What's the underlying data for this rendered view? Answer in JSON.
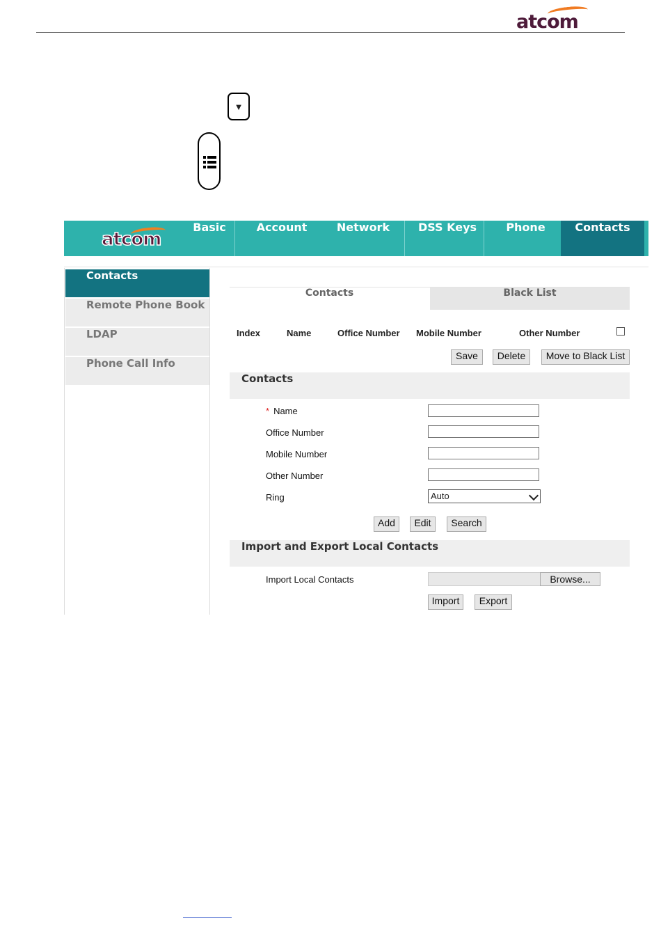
{
  "doc": {
    "logo_text": "atcom"
  },
  "ui": {
    "logo_text": "atcom",
    "nav": [
      "Basic",
      "Account",
      "Network",
      "DSS Keys",
      "Phone",
      "Contacts"
    ],
    "sidebar": [
      "Contacts",
      "Remote Phone Book",
      "LDAP",
      "Phone Call Info"
    ],
    "subtabs": [
      "Contacts",
      "Black List"
    ],
    "columns": [
      "Index",
      "Name",
      "Office Number",
      "Mobile Number",
      "Other Number"
    ],
    "list_buttons": {
      "save": "Save",
      "delete": "Delete",
      "move": "Move to Black List"
    },
    "contacts_section": {
      "title": "Contacts",
      "required_mark": "*",
      "fields": [
        "Name",
        "Office Number",
        "Mobile Number",
        "Other Number",
        "Ring"
      ],
      "ring_value": "Auto",
      "buttons": {
        "add": "Add",
        "edit": "Edit",
        "search": "Search"
      }
    },
    "import_section": {
      "title": "Import and Export Local Contacts",
      "label": "Import Local Contacts",
      "browse": "Browse...",
      "import": "Import",
      "export": "Export"
    }
  }
}
